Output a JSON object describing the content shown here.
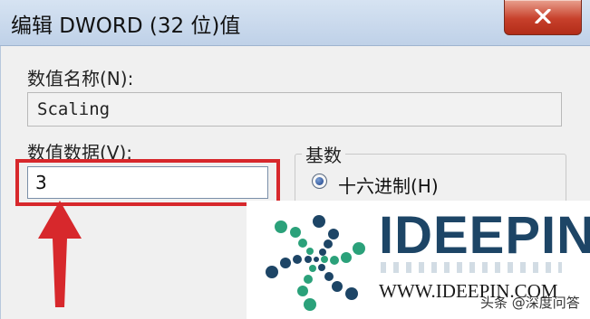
{
  "window": {
    "title": "编辑 DWORD (32 位)值"
  },
  "fields": {
    "name_label": "数值名称(N):",
    "name_value": "Scaling",
    "data_label": "数值数据(V):",
    "data_value": "3"
  },
  "base": {
    "title": "基数",
    "selected_option": "十六进制(H)"
  },
  "watermark": {
    "brand": "IDEEPIN",
    "url": "WWW.IDEEPIN.COM",
    "credit": "头条 @深度问答"
  },
  "colors": {
    "highlight": "#d7282c",
    "arrow": "#d7282c",
    "brand": "#1d4566"
  },
  "icons": [
    "close-icon",
    "radio-selected-icon",
    "up-arrow-icon",
    "logo-icon"
  ]
}
